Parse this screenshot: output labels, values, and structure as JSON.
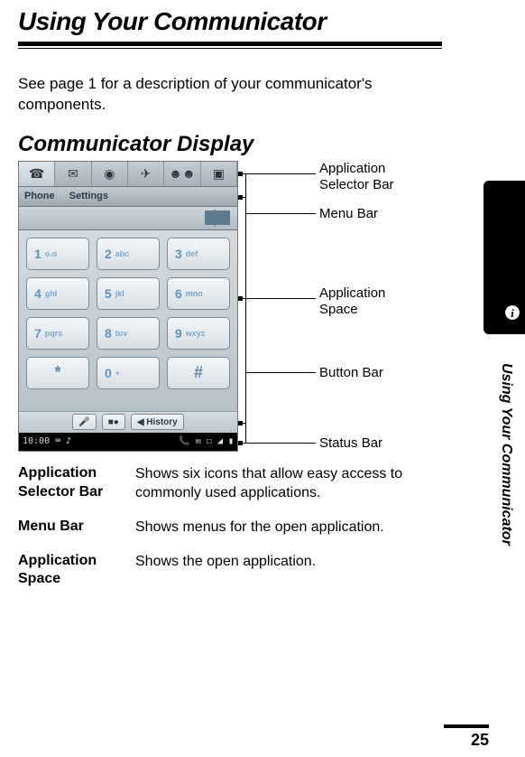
{
  "title": "Using Your Communicator",
  "intro": "See page 1 for a description of your communicator's components.",
  "section": "Communicator Display",
  "callouts": {
    "a": "Application Selector Bar",
    "b": "Menu Bar",
    "c": "Application Space",
    "d": "Button Bar",
    "e": "Status Bar"
  },
  "side_text": "Using Your Communicator",
  "screenshot": {
    "menu": {
      "m1": "Phone",
      "m2": "Settings"
    },
    "keys": {
      "k1n": "1",
      "k1s": "o.o",
      "k2n": "2",
      "k2s": "abc",
      "k3n": "3",
      "k3s": "def",
      "k4n": "4",
      "k4s": "ghi",
      "k5n": "5",
      "k5s": "jkl",
      "k6n": "6",
      "k6s": "mno",
      "k7n": "7",
      "k7s": "pqrs",
      "k8n": "8",
      "k8s": "tuv",
      "k9n": "9",
      "k9s": "wxyz",
      "ks1": "*",
      "k0n": "0",
      "k0s": "+",
      "ks2": "#"
    },
    "buttonbar": {
      "b1": "◀ History"
    },
    "status": {
      "time": "10:00"
    }
  },
  "defs": [
    {
      "term": "Application Selector Bar",
      "desc": "Shows six icons that allow easy access to commonly used applications."
    },
    {
      "term": "Menu Bar",
      "desc": "Shows menus for the open application."
    },
    {
      "term": "Application Space",
      "desc": "Shows the open application."
    }
  ],
  "page_number": "25"
}
